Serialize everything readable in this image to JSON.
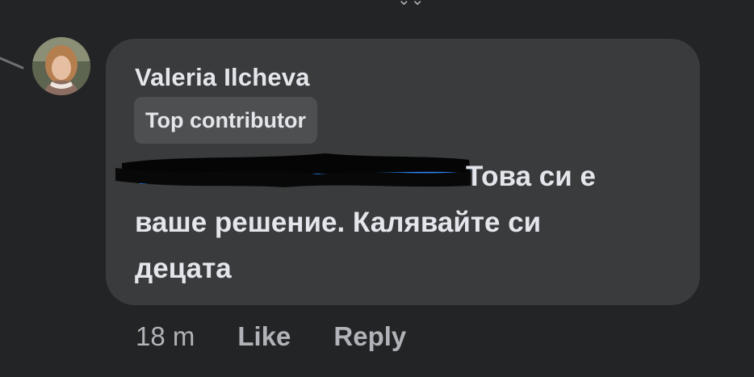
{
  "comment": {
    "author": "Valeria Ilcheva",
    "badge": "Top contributor",
    "text": "Това си е ваше решение. Калявайте си децата",
    "text_line1": "Това си е",
    "text_line2": "ваше решение. Калявайте си",
    "text_line3": "децата",
    "avatar_icon": "user-avatar-photo",
    "redacted_mention_icon": "redaction-scribble"
  },
  "actions": {
    "time": "18 m",
    "like_label": "Like",
    "reply_label": "Reply"
  },
  "colors": {
    "background": "#232425",
    "bubble": "#3a3b3c",
    "badge": "#4e4f50",
    "primary_text": "#e4e6eb",
    "secondary_text": "#b0b3b8",
    "mention_blue": "#2d88ff"
  }
}
